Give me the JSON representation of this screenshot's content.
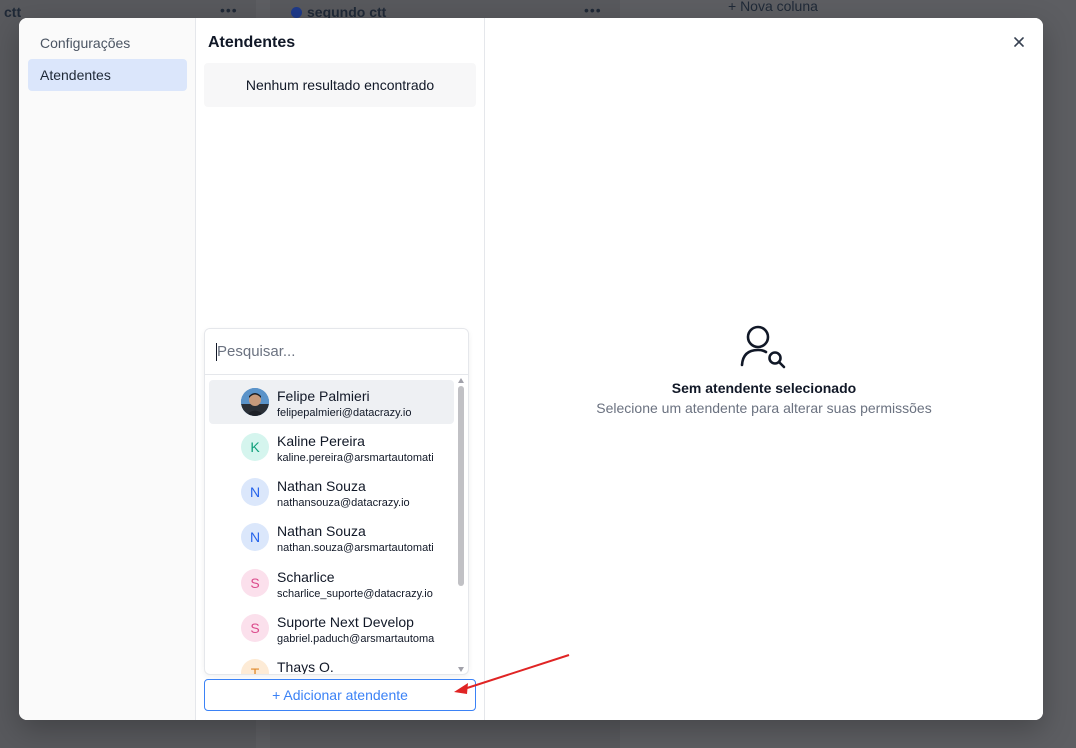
{
  "background": {
    "col1_title": "ctt",
    "col2_title": "segundo ctt",
    "new_column": "+ Nova coluna",
    "menu_dots": "•••"
  },
  "nav": {
    "items": [
      {
        "label": "Configurações",
        "active": false
      },
      {
        "label": "Atendentes",
        "active": true
      }
    ]
  },
  "list_panel": {
    "title": "Atendentes",
    "empty_text": "Nenhum resultado encontrado",
    "add_button": "+ Adicionar atendente"
  },
  "search": {
    "placeholder": "Pesquisar...",
    "value": ""
  },
  "agents": [
    {
      "name": "Felipe Palmieri",
      "email": "felipepalmieri@datacrazy.io",
      "initial": "",
      "avatar": "photo",
      "highlighted": true
    },
    {
      "name": "Kaline Pereira",
      "email": "kaline.pereira@arsmartautomati",
      "initial": "K",
      "avatar": "teal"
    },
    {
      "name": "Nathan Souza",
      "email": "nathansouza@datacrazy.io",
      "initial": "N",
      "avatar": "blue"
    },
    {
      "name": "Nathan Souza",
      "email": "nathan.souza@arsmartautomati",
      "initial": "N",
      "avatar": "blue"
    },
    {
      "name": "Scharlice",
      "email": "scharlice_suporte@datacrazy.io",
      "initial": "S",
      "avatar": "pink"
    },
    {
      "name": "Suporte Next Develop",
      "email": "gabriel.paduch@arsmartautoma",
      "initial": "S",
      "avatar": "pink"
    },
    {
      "name": "Thays O.",
      "email": "",
      "initial": "T",
      "avatar": "orange"
    }
  ],
  "avatar_colors": {
    "teal": {
      "bg": "#d5f5ee",
      "fg": "#0f9f7a"
    },
    "blue": {
      "bg": "#dbe7fb",
      "fg": "#2563eb"
    },
    "pink": {
      "bg": "#fbe0ec",
      "fg": "#db4b8c"
    },
    "orange": {
      "bg": "#fdebd6",
      "fg": "#e08a2c"
    }
  },
  "detail": {
    "empty_title": "Sem atendente selecionado",
    "empty_desc": "Selecione um atendente para alterar suas permissões"
  },
  "accent_color": "#3b82f6"
}
